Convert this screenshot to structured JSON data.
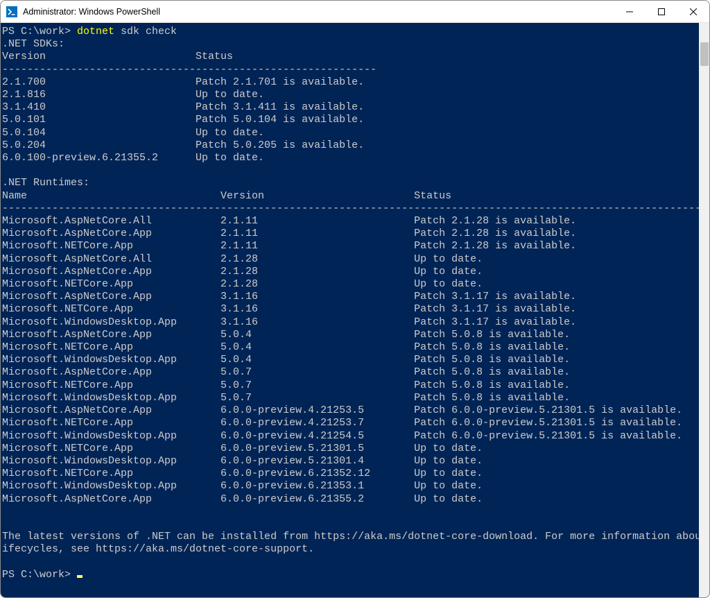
{
  "window": {
    "title": "Administrator: Windows PowerShell"
  },
  "prompt1_prefix": "PS C:\\work> ",
  "prompt1_cmd": "dotnet",
  "prompt1_args": " sdk check",
  "sdk_header": ".NET SDKs:",
  "sdk_col_version": "Version",
  "sdk_col_status": "Status",
  "sdk_sep": "------------------------------------------------------------",
  "sdks": [
    {
      "v": "2.1.700",
      "s": "Patch 2.1.701 is available."
    },
    {
      "v": "2.1.816",
      "s": "Up to date."
    },
    {
      "v": "3.1.410",
      "s": "Patch 3.1.411 is available."
    },
    {
      "v": "5.0.101",
      "s": "Patch 5.0.104 is available."
    },
    {
      "v": "5.0.104",
      "s": "Up to date."
    },
    {
      "v": "5.0.204",
      "s": "Patch 5.0.205 is available."
    },
    {
      "v": "6.0.100-preview.6.21355.2",
      "s": "Up to date."
    }
  ],
  "rt_header": ".NET Runtimes:",
  "rt_col_name": "Name",
  "rt_col_version": "Version",
  "rt_col_status": "Status",
  "rt_sep": "-----------------------------------------------------------------------------------------------------------------",
  "runtimes": [
    {
      "n": "Microsoft.AspNetCore.All",
      "v": "2.1.11",
      "s": "Patch 2.1.28 is available."
    },
    {
      "n": "Microsoft.AspNetCore.App",
      "v": "2.1.11",
      "s": "Patch 2.1.28 is available."
    },
    {
      "n": "Microsoft.NETCore.App",
      "v": "2.1.11",
      "s": "Patch 2.1.28 is available."
    },
    {
      "n": "Microsoft.AspNetCore.All",
      "v": "2.1.28",
      "s": "Up to date."
    },
    {
      "n": "Microsoft.AspNetCore.App",
      "v": "2.1.28",
      "s": "Up to date."
    },
    {
      "n": "Microsoft.NETCore.App",
      "v": "2.1.28",
      "s": "Up to date."
    },
    {
      "n": "Microsoft.AspNetCore.App",
      "v": "3.1.16",
      "s": "Patch 3.1.17 is available."
    },
    {
      "n": "Microsoft.NETCore.App",
      "v": "3.1.16",
      "s": "Patch 3.1.17 is available."
    },
    {
      "n": "Microsoft.WindowsDesktop.App",
      "v": "3.1.16",
      "s": "Patch 3.1.17 is available."
    },
    {
      "n": "Microsoft.AspNetCore.App",
      "v": "5.0.4",
      "s": "Patch 5.0.8 is available."
    },
    {
      "n": "Microsoft.NETCore.App",
      "v": "5.0.4",
      "s": "Patch 5.0.8 is available."
    },
    {
      "n": "Microsoft.WindowsDesktop.App",
      "v": "5.0.4",
      "s": "Patch 5.0.8 is available."
    },
    {
      "n": "Microsoft.AspNetCore.App",
      "v": "5.0.7",
      "s": "Patch 5.0.8 is available."
    },
    {
      "n": "Microsoft.NETCore.App",
      "v": "5.0.7",
      "s": "Patch 5.0.8 is available."
    },
    {
      "n": "Microsoft.WindowsDesktop.App",
      "v": "5.0.7",
      "s": "Patch 5.0.8 is available."
    },
    {
      "n": "Microsoft.AspNetCore.App",
      "v": "6.0.0-preview.4.21253.5",
      "s": "Patch 6.0.0-preview.5.21301.5 is available."
    },
    {
      "n": "Microsoft.NETCore.App",
      "v": "6.0.0-preview.4.21253.7",
      "s": "Patch 6.0.0-preview.5.21301.5 is available."
    },
    {
      "n": "Microsoft.WindowsDesktop.App",
      "v": "6.0.0-preview.4.21254.5",
      "s": "Patch 6.0.0-preview.5.21301.5 is available."
    },
    {
      "n": "Microsoft.NETCore.App",
      "v": "6.0.0-preview.5.21301.5",
      "s": "Up to date."
    },
    {
      "n": "Microsoft.WindowsDesktop.App",
      "v": "6.0.0-preview.5.21301.4",
      "s": "Up to date."
    },
    {
      "n": "Microsoft.NETCore.App",
      "v": "6.0.0-preview.6.21352.12",
      "s": "Up to date."
    },
    {
      "n": "Microsoft.WindowsDesktop.App",
      "v": "6.0.0-preview.6.21353.1",
      "s": "Up to date."
    },
    {
      "n": "Microsoft.AspNetCore.App",
      "v": "6.0.0-preview.6.21355.2",
      "s": "Up to date."
    }
  ],
  "footer1": "The latest versions of .NET can be installed from https://aka.ms/dotnet-core-download. For more information about .NET l",
  "footer2": "ifecycles, see https://aka.ms/dotnet-core-support.",
  "prompt2_prefix": "PS C:\\work> "
}
